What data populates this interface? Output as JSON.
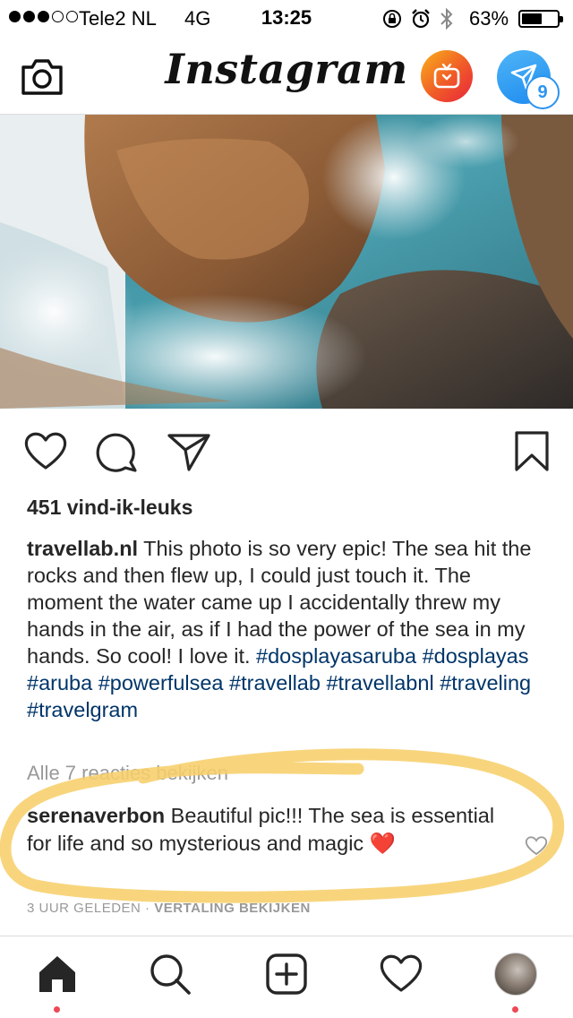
{
  "status_bar": {
    "carrier": "Tele2 NL",
    "network": "4G",
    "time": "13:25",
    "battery_percent": "63%",
    "battery_level": 0.63,
    "signal_bars": 3,
    "signal_total": 5
  },
  "header": {
    "logo": "Instagram",
    "direct_badge": "9"
  },
  "post": {
    "likes": "451 vind-ik-leuks",
    "caption": {
      "username": "travellab.nl",
      "text": " This photo is so very epic! The sea hit the rocks and then flew up, I could just touch it. The moment the water came up I accidentally threw my hands in the air, as if I had the power of the sea in my hands. So cool! I love it. ",
      "hashtags": [
        "#dosplayasaruba",
        "#dosplayas",
        "#aruba",
        "#powerfulsea",
        "#travellab",
        "#travellabnl",
        "#traveling",
        "#travelgram"
      ]
    },
    "view_all_comments": "Alle 7 reacties bekijken",
    "comment": {
      "username": "serenaverbon",
      "text": " Beautiful pic!!! The sea is essential for life and so mysterious and magic ",
      "emoji": "❤️"
    },
    "time_ago": "3 UUR GELEDEN",
    "separator": " · ",
    "translate": "VERTALING BEKIJKEN"
  },
  "colors": {
    "hashtag": "#003569",
    "muted": "#999999",
    "highlight": "#f7cf6b",
    "notification": "#ed4956",
    "direct_blue": "#2b94ef"
  },
  "icons": {
    "header": [
      "camera-icon",
      "igtv-icon",
      "direct-icon"
    ],
    "actions": [
      "heart-icon",
      "comment-icon",
      "share-icon",
      "bookmark-icon"
    ],
    "tabs": [
      "home-icon",
      "search-icon",
      "add-icon",
      "activity-heart-icon",
      "profile-avatar"
    ]
  }
}
